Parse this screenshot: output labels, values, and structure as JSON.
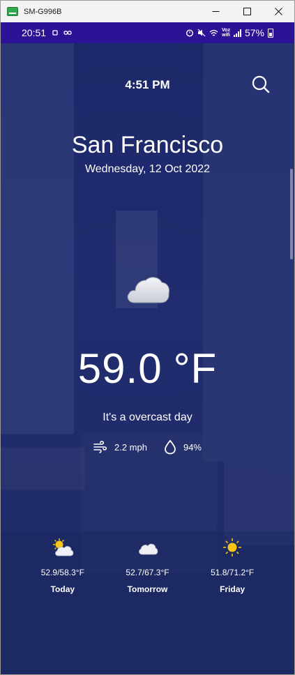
{
  "window": {
    "title": "SM-G996B"
  },
  "status_bar": {
    "time": "20:51",
    "network_label": "Voz\nwifi",
    "battery_percent": "57%"
  },
  "header": {
    "time": "4:51 PM"
  },
  "location": {
    "city": "San Francisco",
    "date": "Wednesday, 12 Oct 2022"
  },
  "current": {
    "icon": "cloud-icon",
    "temperature": "59.0",
    "unit": "°F",
    "description": "It's a overcast day",
    "wind": "2.2 mph",
    "humidity": "94%"
  },
  "forecast": [
    {
      "icon": "partly-sunny-icon",
      "range": "52.9/58.3°F",
      "day": "Today"
    },
    {
      "icon": "cloud-icon",
      "range": "52.7/67.3°F",
      "day": "Tomorrow"
    },
    {
      "icon": "sun-icon",
      "range": "51.8/71.2°F",
      "day": "Friday"
    }
  ],
  "colors": {
    "status_bar": "#2c1396",
    "app_background": "#1d2a6e",
    "text": "#ffffff",
    "sun": "#f5c518",
    "cloud": "#e6e8ee"
  }
}
